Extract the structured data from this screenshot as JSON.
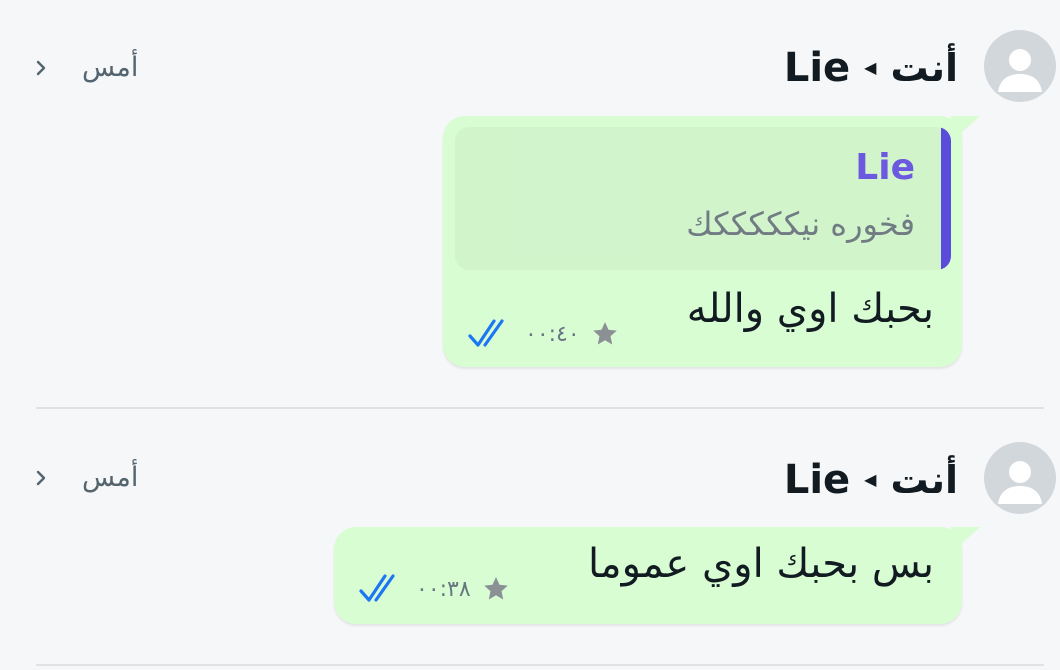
{
  "messages": [
    {
      "sender": "أنت",
      "recipient": "Lie",
      "date": "أمس",
      "quote": {
        "author": "Lie",
        "text": "فخوره نيكككككك"
      },
      "text": "بحبك اوي والله",
      "time": "٠٠:٤٠",
      "starred": true,
      "status": "read"
    },
    {
      "sender": "أنت",
      "recipient": "Lie",
      "date": "أمس",
      "text": "بس بحبك اوي عموما",
      "time": "٠٠:٣٨",
      "starred": true,
      "status": "read"
    }
  ],
  "colors": {
    "bubble": "#d9fdd3",
    "quote_accent": "#5b4bdb",
    "read_ticks": "#1d77f2",
    "star": "#8a9094"
  },
  "icons": {
    "avatar": "default-avatar-icon",
    "arrow": "caret-left-icon",
    "chevron": "chevron-right-icon",
    "star": "star-icon",
    "ticks": "double-check-icon"
  }
}
